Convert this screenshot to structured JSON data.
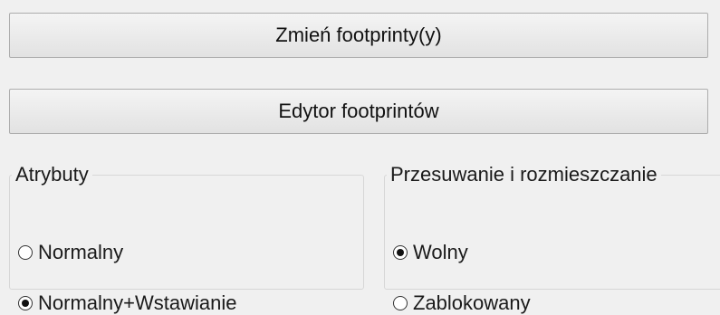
{
  "buttons": {
    "change_footprints": "Zmień footprinty(y)",
    "footprint_editor": "Edytor footprintów"
  },
  "attributes_group": {
    "title": "Atrybuty",
    "options": [
      {
        "label": "Normalny",
        "selected": false
      },
      {
        "label": "Normalny+Wstawianie",
        "selected": true
      }
    ]
  },
  "move_group": {
    "title": "Przesuwanie i rozmieszczanie",
    "options": [
      {
        "label": "Wolny",
        "selected": true
      },
      {
        "label": "Zablokowany",
        "selected": false
      }
    ]
  }
}
